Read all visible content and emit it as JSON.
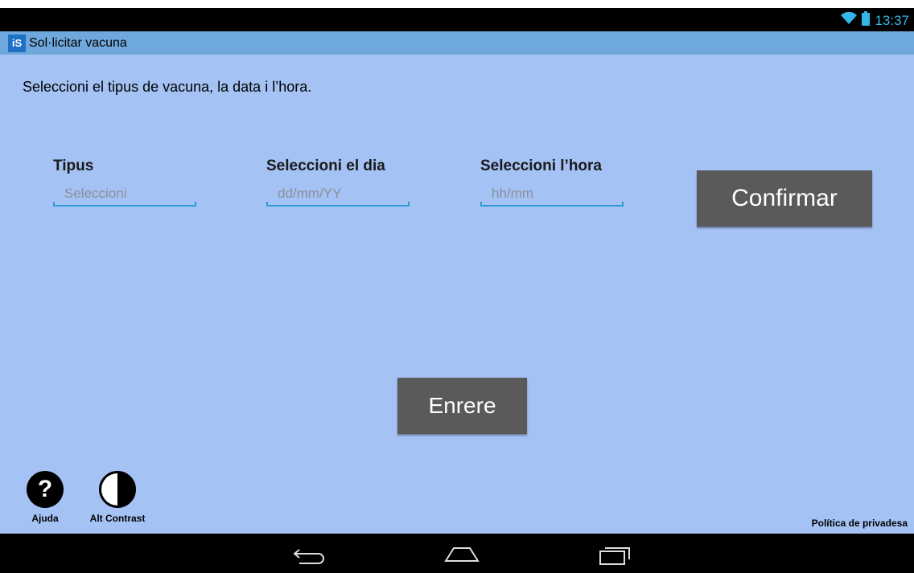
{
  "status": {
    "time": "13:37"
  },
  "title": {
    "app_icon_letters": "iS",
    "text": "Sol·licitar vacuna"
  },
  "instruction": "Seleccioni el tipus de vacuna, la data i l’hora.",
  "fields": [
    {
      "label": "Tipus",
      "placeholder": "Seleccioni"
    },
    {
      "label": "Seleccioni el dia",
      "placeholder": "dd/mm/YY"
    },
    {
      "label": "Seleccioni l’hora",
      "placeholder": "hh/mm"
    }
  ],
  "buttons": {
    "confirm": "Confirmar",
    "back": "Enrere"
  },
  "bottom": {
    "help_label": "Ajuda",
    "help_symbol": "?",
    "contrast_label": "Alt Contrast",
    "privacy": "Política de privadesa"
  },
  "colors": {
    "content_bg": "#a4c2f4",
    "titlebar_bg": "#6fa8dc",
    "button_bg": "#5a5a5a",
    "accent": "#2e9bd6",
    "status_icon": "#33b5e5"
  },
  "icons": [
    "wifi-icon",
    "battery-icon",
    "help-icon",
    "contrast-icon",
    "back-nav-icon",
    "home-nav-icon",
    "recents-nav-icon"
  ]
}
